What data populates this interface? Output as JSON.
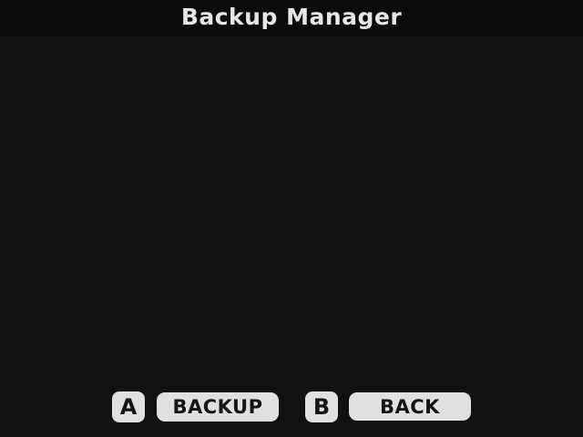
{
  "header": {
    "title": "Backup Manager"
  },
  "footer": {
    "buttons": [
      {
        "key": "A",
        "label": "BACKUP"
      },
      {
        "key": "B",
        "label": "BACK"
      }
    ]
  },
  "colors": {
    "background": "#111111",
    "header_background": "#0c0c0c",
    "title_text": "#e6e6e6",
    "button_background": "#e0e0e0",
    "button_text": "#151515"
  }
}
